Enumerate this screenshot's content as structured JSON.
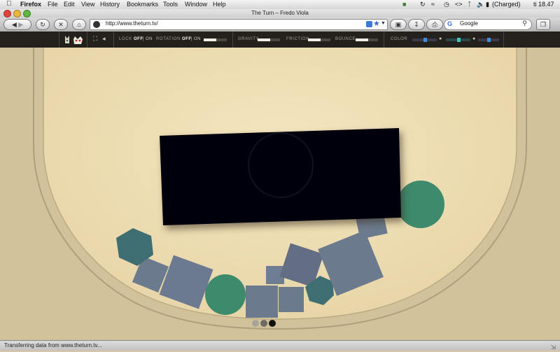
{
  "menubar": {
    "app": "Firefox",
    "items": [
      "File",
      "Edit",
      "View",
      "History",
      "Bookmarks",
      "Tools",
      "Window",
      "Help"
    ],
    "battery": "(Charged)",
    "clock": "ti 18.47"
  },
  "window": {
    "title": "The Turn – Fredo Viola"
  },
  "toolbar": {
    "url": "http://www.theturn.tv/",
    "search_engine": "Google",
    "search_placeholder": "Google"
  },
  "site_controls": {
    "lock": {
      "label": "LOCK",
      "off": "OFF",
      "on": "ON"
    },
    "rotation": {
      "label": "ROTATION",
      "off": "OFF",
      "on": "ON",
      "level": 0.55
    },
    "gravity": {
      "label": "GRAVITY",
      "level": 0.55
    },
    "friction": {
      "label": "FRICTION",
      "level": 0.55
    },
    "bounce": {
      "label": "BOUNCE",
      "level": 0.55
    },
    "color": {
      "label": "COLOR",
      "channels": [
        0.5,
        0.5,
        0.5
      ]
    }
  },
  "colors": {
    "paper": "#ecdcb2",
    "shape_gray": "#6c7a8e",
    "shape_teal": "#3f6e72",
    "shape_green": "#3d8a6c",
    "dark_panel": "#05060f",
    "accent_blue": "#3a8fd8"
  },
  "status": {
    "text": "Transferring data from www.theturn.tv..."
  }
}
